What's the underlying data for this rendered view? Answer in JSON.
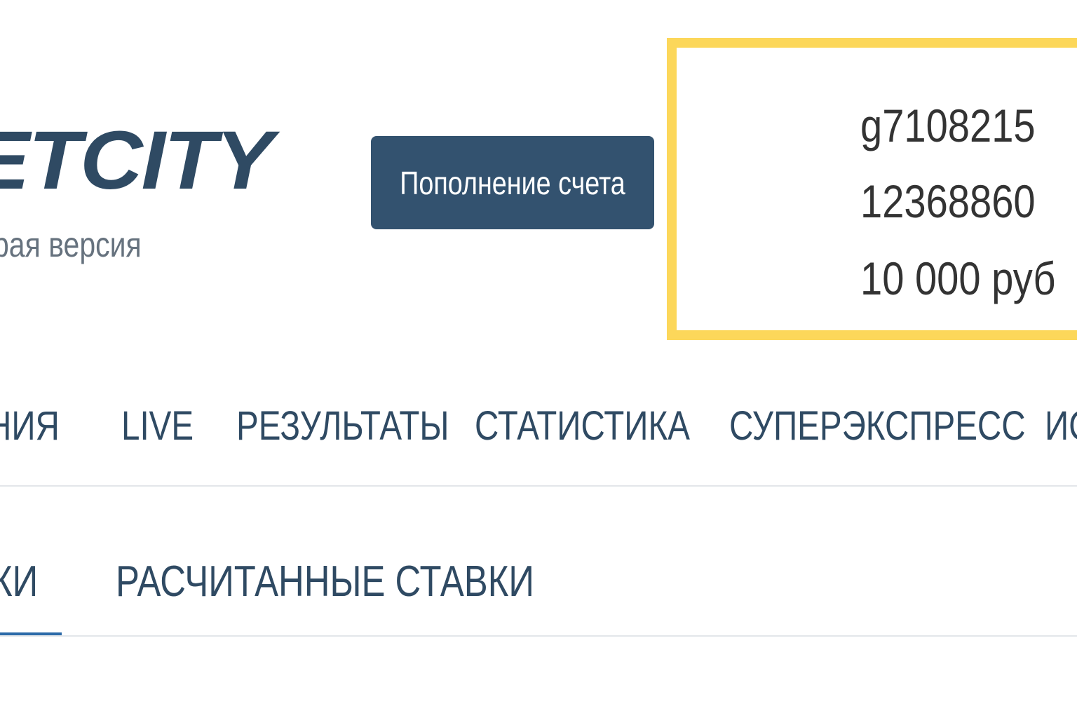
{
  "header": {
    "logo_text": "ETCITY",
    "logo_subtitle": "рая версия",
    "deposit_button_label": "Пополнение счета"
  },
  "account": {
    "login": "g7108215",
    "account_number": "12368860",
    "balance": "10 000 руб"
  },
  "main_nav": {
    "items": [
      {
        "label": "НИЯ"
      },
      {
        "label": "LIVE"
      },
      {
        "label": "РЕЗУЛЬТАТЫ"
      },
      {
        "label": "СТАТИСТИКА"
      },
      {
        "label": "СУПЕРЭКСПРЕСС"
      },
      {
        "label": "ИС"
      }
    ]
  },
  "sub_tabs": {
    "items": [
      {
        "label": "КИ",
        "active": true
      },
      {
        "label": "РАСЧИТАННЫЕ СТАВКИ",
        "active": false
      }
    ]
  },
  "colors": {
    "brand": "#2f4a63",
    "button_bg": "#33526f",
    "highlight_border": "#fcd75a",
    "active_tab_underline": "#2c6aa8"
  }
}
